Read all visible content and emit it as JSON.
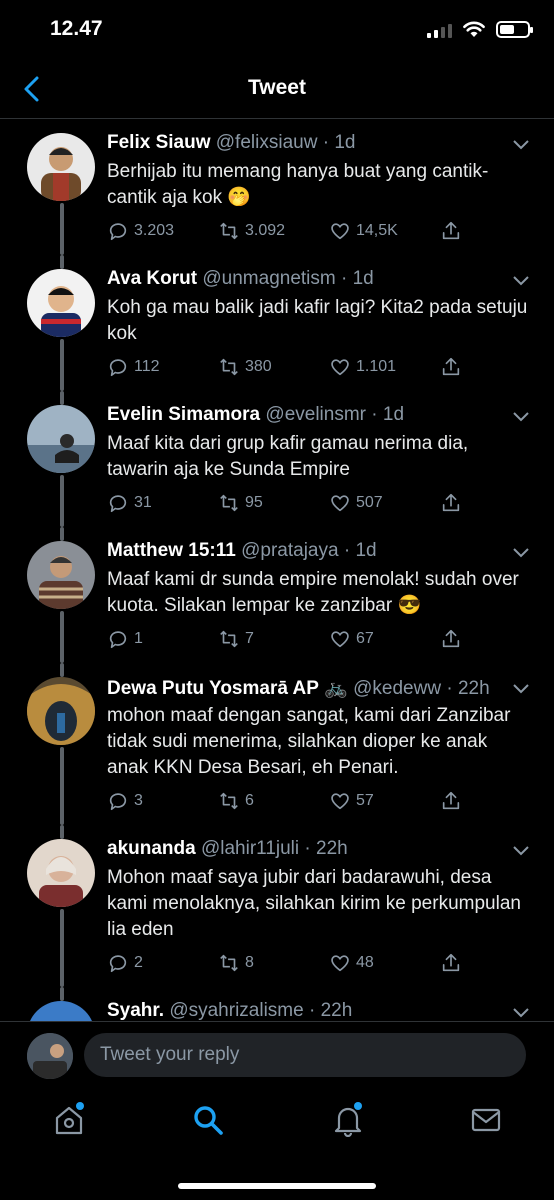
{
  "status_bar": {
    "time": "12.47"
  },
  "header": {
    "title": "Tweet"
  },
  "tweets": [
    {
      "name": "Felix Siauw",
      "handle": "@felixsiauw",
      "dot": "·",
      "ago": "1d",
      "text": "Berhijab itu memang hanya buat yang cantik-cantik aja kok",
      "emoji": "🤭",
      "replies": "3.203",
      "retweets": "3.092",
      "likes": "14,5K"
    },
    {
      "name": "Ava Korut",
      "handle": "@unmagnetism",
      "dot": "·",
      "ago": "1d",
      "text": "Koh ga mau balik jadi kafir lagi? Kita2 pada setuju kok",
      "emoji": "",
      "replies": "112",
      "retweets": "380",
      "likes": "1.101"
    },
    {
      "name": "Evelin Simamora",
      "handle": "@evelinsmr",
      "dot": "·",
      "ago": "1d",
      "text": "Maaf kita dari grup kafir gamau nerima dia, tawarin aja ke Sunda Empire",
      "emoji": "",
      "replies": "31",
      "retweets": "95",
      "likes": "507"
    },
    {
      "name": "Matthew 15:11",
      "handle": "@pratajaya",
      "dot": "·",
      "ago": "1d",
      "text": "Maaf kami dr sunda empire menolak! sudah over kuota. Silakan lempar ke zanzibar",
      "emoji": "😎",
      "replies": "1",
      "retweets": "7",
      "likes": "67"
    },
    {
      "name": "Dewa Putu Yosmarā AP",
      "badge": "🚲",
      "handle": "@kedeww",
      "dot": "·",
      "ago": "22h",
      "text": "mohon maaf dengan sangat, kami dari Zanzibar tidak sudi menerima, silahkan dioper ke anak anak KKN Desa Besari, eh Penari.",
      "emoji": "",
      "replies": "3",
      "retweets": "6",
      "likes": "57"
    },
    {
      "name": "akunanda",
      "handle": "@lahir11juli",
      "dot": "·",
      "ago": "22h",
      "text": "Mohon maaf saya jubir dari badarawuhi, desa kami menolaknya,  silahkan kirim ke perkumpulan lia eden",
      "emoji": "",
      "replies": "2",
      "retweets": "8",
      "likes": "48"
    },
    {
      "name": "Syahr.",
      "handle": "@syahrizalisme",
      "dot": "·",
      "ago": "22h",
      "text": "",
      "emoji": ""
    }
  ],
  "reply_bar": {
    "placeholder": "Tweet your reply"
  },
  "colors": {
    "accent": "#1da1f2",
    "background": "#000000",
    "secondary_text": "#8b98a5"
  },
  "icons": [
    "back-chevron-icon",
    "caret-down-icon",
    "reply-icon",
    "retweet-icon",
    "like-icon",
    "share-icon",
    "home-icon",
    "search-icon",
    "notifications-icon",
    "messages-icon"
  ]
}
